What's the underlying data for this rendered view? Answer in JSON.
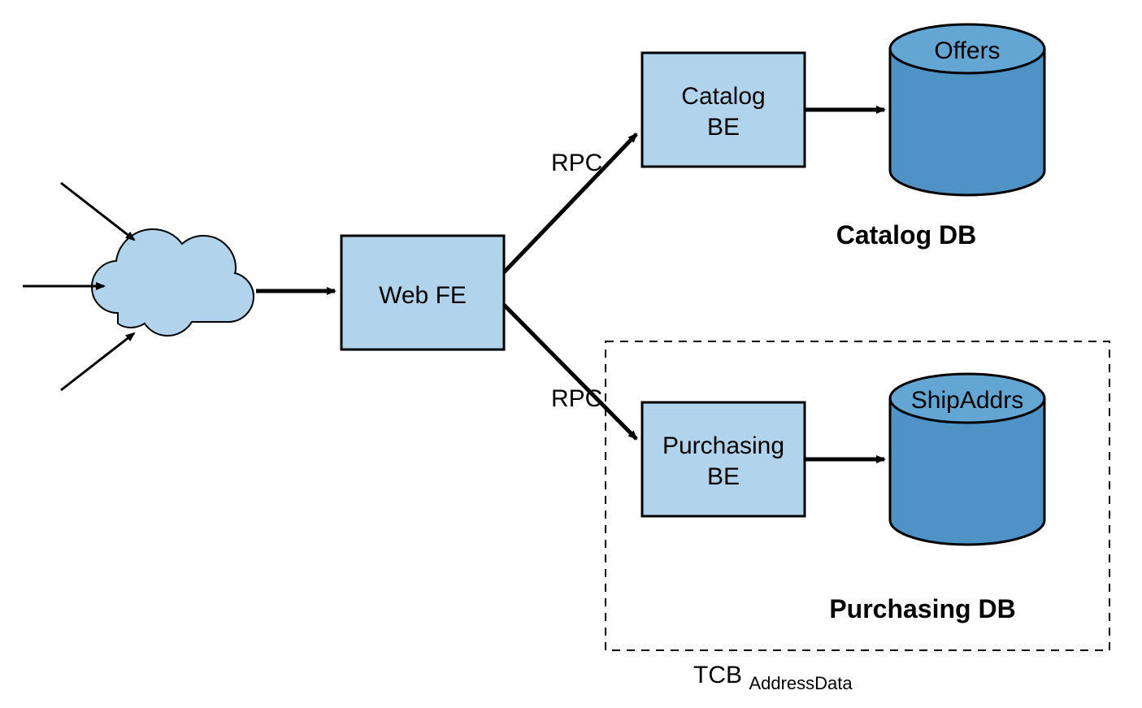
{
  "nodes": {
    "web_fe": {
      "label": "Web FE"
    },
    "catalog_be": {
      "label_line1": "Catalog",
      "label_line2": "BE"
    },
    "purchasing_be": {
      "label_line1": "Purchasing",
      "label_line2": "BE"
    },
    "offers_db": {
      "label": "Offers"
    },
    "shipaddrs_db": {
      "label": "ShipAddrs"
    }
  },
  "edges": {
    "rpc1": {
      "label": "RPC"
    },
    "rpc2": {
      "label": "RPC"
    }
  },
  "sections": {
    "catalog_db": {
      "label": "Catalog DB"
    },
    "purchasing_db": {
      "label": "Purchasing DB"
    }
  },
  "tcb": {
    "prefix": "TCB",
    "sub": "AddressData"
  },
  "colors": {
    "box_fill": "#B2D3EC",
    "cloud_fill": "#B2D3EC",
    "cyl_top_fill": "#64A6D3",
    "cyl_body_fill": "#4F93C6",
    "stroke": "#000000"
  }
}
